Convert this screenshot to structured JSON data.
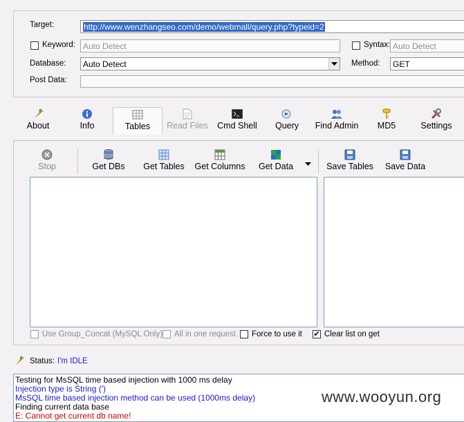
{
  "form": {
    "target_label": "Target:",
    "target_value": "http://www.wenzhangseo.com/demo/webmall/query.php?typeid=2",
    "keyword_label": "Keyword:",
    "keyword_value": "Auto Detect",
    "syntax_label": "Syntax:",
    "syntax_value": "Auto Detect",
    "database_label": "Database:",
    "database_value": "Auto Detect",
    "method_label": "Method:",
    "method_value": "GET",
    "postdata_label": "Post Data:"
  },
  "tabs": [
    {
      "label": "About",
      "icon": "carrot-icon"
    },
    {
      "label": "Info",
      "icon": "info-icon"
    },
    {
      "label": "Tables",
      "icon": "table-icon",
      "active": true
    },
    {
      "label": "Read Files",
      "icon": "document-icon",
      "disabled": true
    },
    {
      "label": "Cmd Shell",
      "icon": "terminal-icon"
    },
    {
      "label": "Query",
      "icon": "query-icon"
    },
    {
      "label": "Find Admin",
      "icon": "users-icon"
    },
    {
      "label": "MD5",
      "icon": "key-icon"
    },
    {
      "label": "Settings",
      "icon": "tools-icon"
    }
  ],
  "toolbar": {
    "stop": "Stop",
    "get_dbs": "Get DBs",
    "get_tables": "Get Tables",
    "get_columns": "Get Columns",
    "get_data": "Get Data",
    "save_tables": "Save Tables",
    "save_data": "Save Data"
  },
  "options": {
    "group_concat": "Use Group_Concat (MySQL Only)",
    "all_in_one": "All in one request.",
    "force": "Force to use it",
    "clear_list": "Clear list on get"
  },
  "status": {
    "label": "Status:",
    "value": "I'm IDLE"
  },
  "log": [
    {
      "text": "Testing for MsSQL time based injection with 1000 ms delay",
      "color": "#000000"
    },
    {
      "text": "Injection type is String (')",
      "color": "#1a1acc"
    },
    {
      "text": "MsSQL time based injection method can be used (1000ms delay)",
      "color": "#1a1acc"
    },
    {
      "text": "Finding current data base",
      "color": "#000000"
    },
    {
      "text": "E: Cannot get current db name!",
      "color": "#cc0000"
    }
  ],
  "watermark": "www.wooyun.org",
  "colors": {
    "background": "#f4f1f4",
    "selection": "#3169c6",
    "log_info": "#1a1acc",
    "log_error": "#cc0000"
  }
}
